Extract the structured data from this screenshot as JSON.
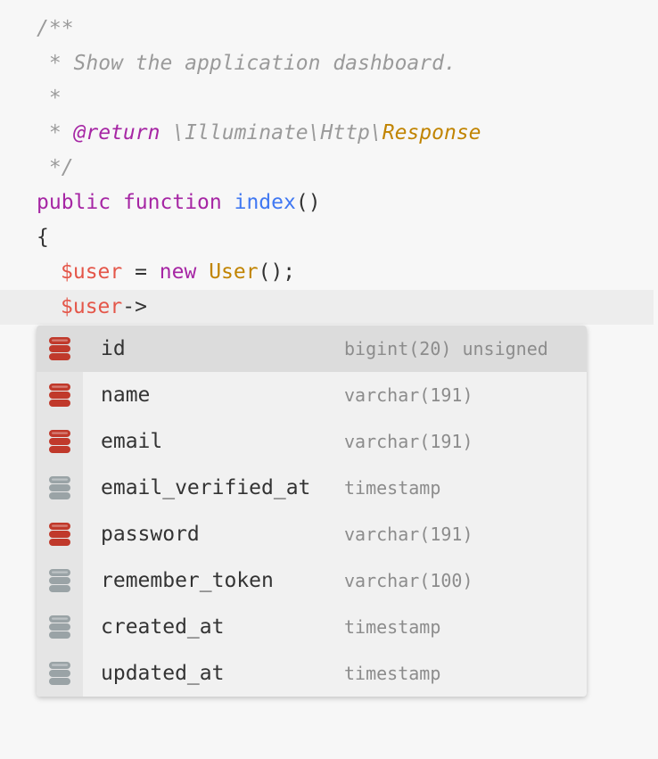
{
  "colors": {
    "key_column_icon": "#c0392b",
    "nullable_column_icon": "#9aa3a6",
    "selected_row": "#dcdcdc",
    "popup_background": "#f1f1f1",
    "current_line": "#ededed"
  },
  "code": {
    "doc_open": "/**",
    "doc_summary": " * Show the application dashboard.",
    "doc_blank": " *",
    "doc_return_prefix": " * ",
    "doc_return_tag": "@return",
    "doc_return_ns": " \\Illuminate\\Http\\",
    "doc_return_type": "Response",
    "doc_close": " */",
    "kw_public": "public",
    "kw_function": "function",
    "fn_name": "index",
    "fn_parens": "()",
    "brace_open": "{",
    "var_user": "$user",
    "assign": " = ",
    "kw_new": "new",
    "class_user": "User",
    "call_end": "();",
    "var_user_2": "$user",
    "arrow": "->"
  },
  "autocomplete": {
    "selected_index": 0,
    "items": [
      {
        "name": "id",
        "type": "bigint(20) unsigned",
        "icon": "database-red-icon"
      },
      {
        "name": "name",
        "type": "varchar(191)",
        "icon": "database-red-icon"
      },
      {
        "name": "email",
        "type": "varchar(191)",
        "icon": "database-red-icon"
      },
      {
        "name": "email_verified_at",
        "type": "timestamp",
        "icon": "database-gray-icon"
      },
      {
        "name": "password",
        "type": "varchar(191)",
        "icon": "database-red-icon"
      },
      {
        "name": "remember_token",
        "type": "varchar(100)",
        "icon": "database-gray-icon"
      },
      {
        "name": "created_at",
        "type": "timestamp",
        "icon": "database-gray-icon"
      },
      {
        "name": "updated_at",
        "type": "timestamp",
        "icon": "database-gray-icon"
      }
    ]
  }
}
